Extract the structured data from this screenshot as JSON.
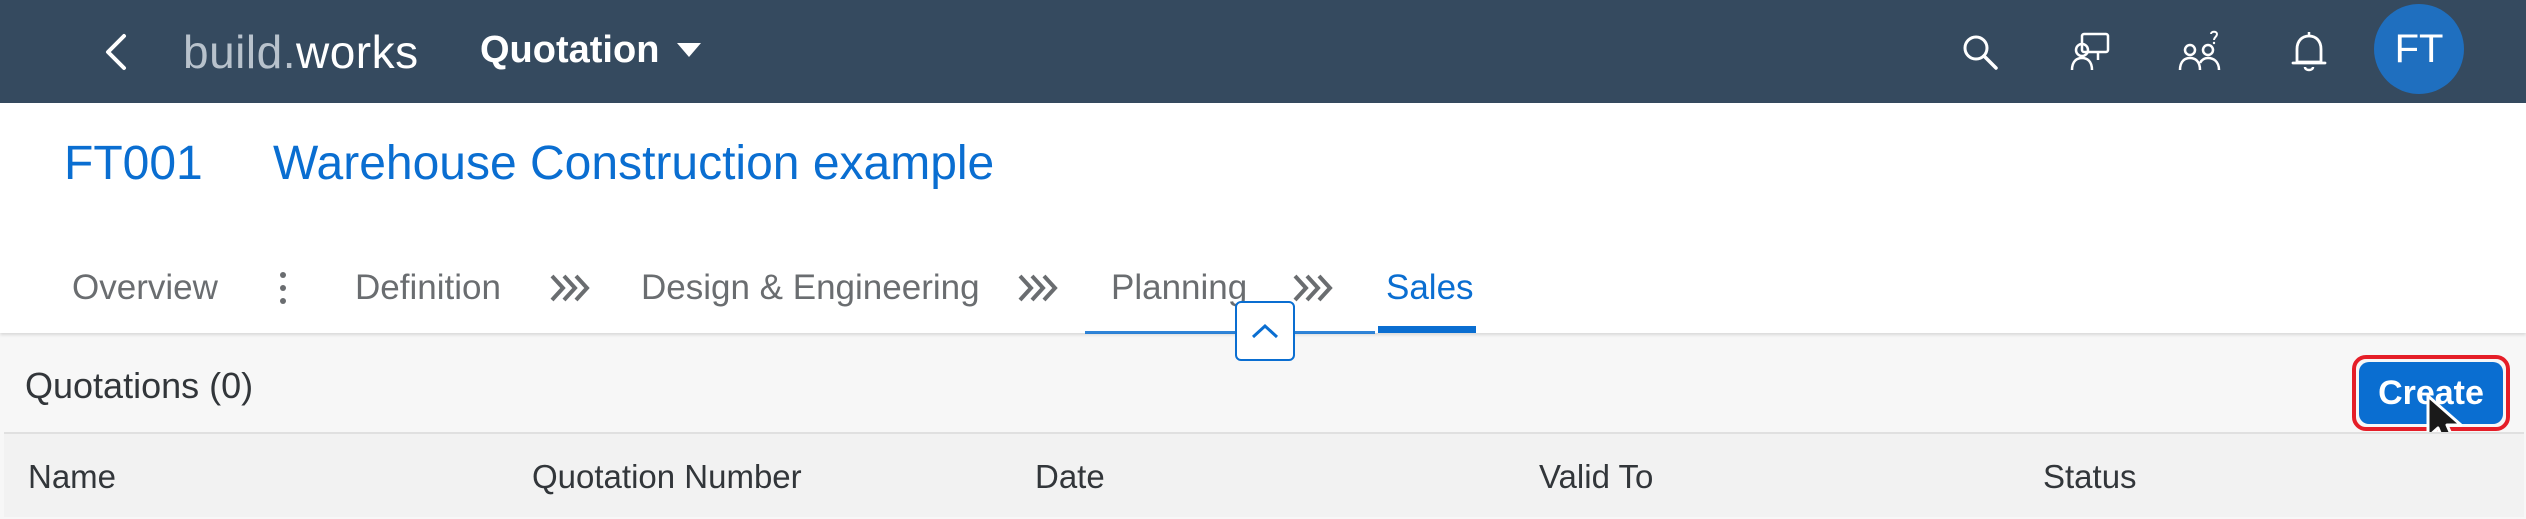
{
  "shell": {
    "logo_part1": "build.",
    "logo_part2": "works",
    "app_title": "Quotation",
    "avatar_initials": "FT",
    "icons": [
      "back-icon",
      "search-icon",
      "feedback-icon",
      "team-icon",
      "notification-bell-icon"
    ]
  },
  "object": {
    "id": "FT001",
    "name": "Warehouse Construction example"
  },
  "tabs": [
    {
      "label": "Overview",
      "active": false
    },
    {
      "label": "Definition",
      "active": false
    },
    {
      "label": "Design & Engineering",
      "active": false
    },
    {
      "label": "Planning",
      "active": false
    },
    {
      "label": "Sales",
      "active": true
    }
  ],
  "section": {
    "title": "Quotations (0)",
    "create_label": "Create"
  },
  "table": {
    "columns": [
      "Name",
      "Quotation Number",
      "Date",
      "Valid To",
      "Status"
    ]
  },
  "colors": {
    "shell": "#354a5f",
    "accent": "#0a6ed1",
    "highlight": "#e51e28"
  }
}
